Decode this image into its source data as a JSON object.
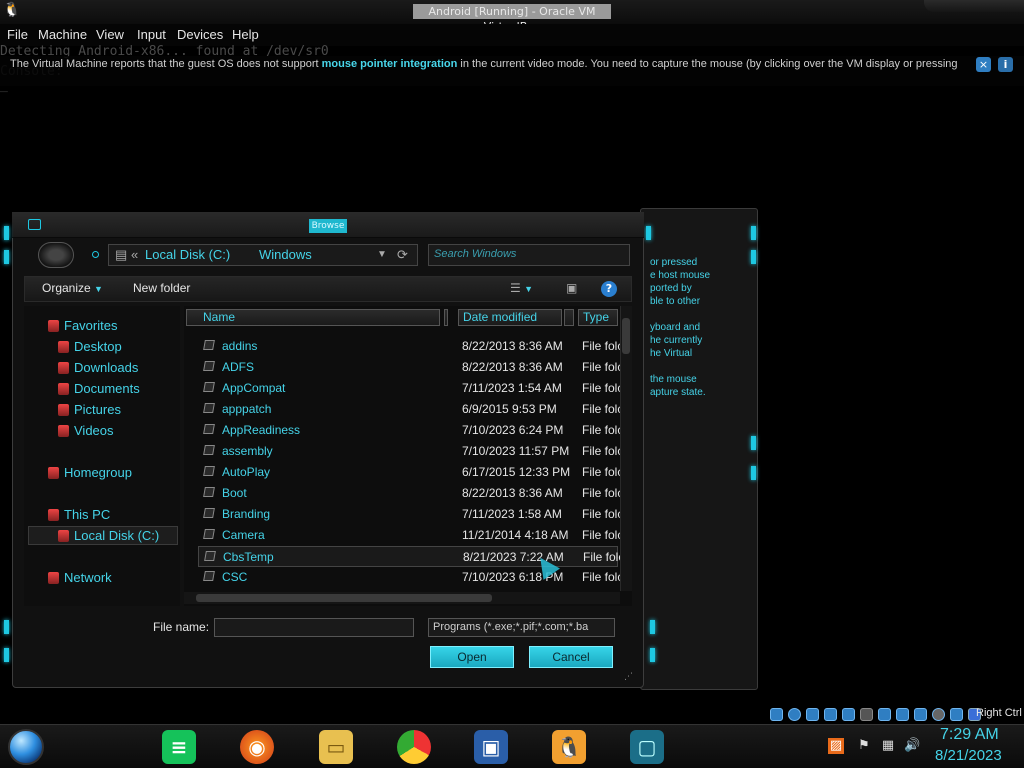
{
  "window": {
    "title": "Android [Running] - Oracle VM VirtualBox"
  },
  "menu": [
    "File",
    "Machine",
    "View",
    "Input",
    "Devices",
    "Help"
  ],
  "console": {
    "line1": "Detecting Android-x86... found at /dev/sr0",
    "line2": "Console: _"
  },
  "notification": {
    "text_before": "The Virtual Machine reports that the guest OS does not support ",
    "text_bold": "mouse pointer integration",
    "text_after": " in the current video mode. You need to capture the mouse (by clicking over the VM display or pressing",
    "close_glyph": "×",
    "info_glyph": "i"
  },
  "background_dialog": {
    "lines": [
      "or pressed",
      "e host mouse",
      "ported by",
      "ble to other",
      "",
      "yboard and",
      "he currently",
      "he Virtual",
      "",
      "the mouse",
      "apture state."
    ]
  },
  "browse": {
    "title": "Browse",
    "breadcrumb": {
      "prefix": "«",
      "seg1": "Local Disk (C:)",
      "seg2": "Windows"
    },
    "search_placeholder": "Search Windows",
    "toolbar": {
      "organize": "Organize",
      "new_folder": "New folder",
      "help": "?"
    },
    "nav": {
      "favorites": "Favorites",
      "desktop": "Desktop",
      "downloads": "Downloads",
      "documents": "Documents",
      "pictures": "Pictures",
      "videos": "Videos",
      "homegroup": "Homegroup",
      "this_pc": "This PC",
      "local_disk": "Local Disk (C:)",
      "network": "Network"
    },
    "columns": {
      "name": "Name",
      "date": "Date modified",
      "type": "Type"
    },
    "rows": [
      {
        "name": "addins",
        "date": "8/22/2013 8:36 AM",
        "type": "File folc"
      },
      {
        "name": "ADFS",
        "date": "8/22/2013 8:36 AM",
        "type": "File folc"
      },
      {
        "name": "AppCompat",
        "date": "7/11/2023 1:54 AM",
        "type": "File folc"
      },
      {
        "name": "apppatch",
        "date": "6/9/2015 9:53 PM",
        "type": "File folc"
      },
      {
        "name": "AppReadiness",
        "date": "7/10/2023 6:24 PM",
        "type": "File folc"
      },
      {
        "name": "assembly",
        "date": "7/10/2023 11:57 PM",
        "type": "File folc"
      },
      {
        "name": "AutoPlay",
        "date": "6/17/2015 12:33 PM",
        "type": "File folc"
      },
      {
        "name": "Boot",
        "date": "8/22/2013 8:36 AM",
        "type": "File folc"
      },
      {
        "name": "Branding",
        "date": "7/11/2023 1:58 AM",
        "type": "File folc"
      },
      {
        "name": "Camera",
        "date": "11/21/2014 4:18 AM",
        "type": "File folc"
      },
      {
        "name": "CbsTemp",
        "date": "8/21/2023 7:22 AM",
        "type": "File folc"
      },
      {
        "name": "CSC",
        "date": "7/10/2023 6:18 PM",
        "type": "File folc"
      }
    ],
    "file_name_label": "File name:",
    "file_name_value": "",
    "file_type": "Programs (*.exe;*.pif;*.com;*.ba",
    "open": "Open",
    "cancel": "Cancel"
  },
  "statusbar": {
    "right_ctrl": "Right Ctrl"
  },
  "taskbar": {
    "time": "7:29 AM",
    "date": "8/21/2023"
  },
  "colors": {
    "accent": "#45d3e8",
    "background": "#000000"
  }
}
